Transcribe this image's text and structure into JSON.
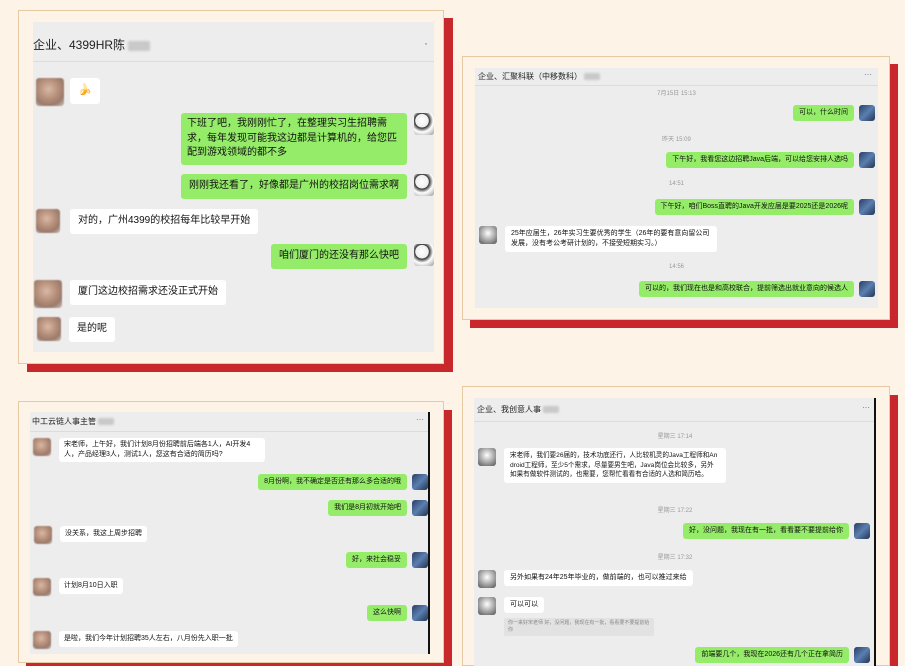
{
  "colors": {
    "accent": "#c8282b",
    "bubble_out": "#95ec69",
    "bubble_in": "#ffffff",
    "chat_bg": "#ededed",
    "page_bg": "#fdf3e7"
  },
  "panel1": {
    "title": "企业、4399HR陈",
    "more": "·",
    "messages": [
      {
        "side": "in",
        "text": "🍌"
      },
      {
        "side": "out",
        "text": "下班了吧，我刚刚忙了，在整理实习生招聘需求，每年发现可能我这边都是计算机的，给您匹配到游戏领域的都不多"
      },
      {
        "side": "out",
        "text": "刚刚我还看了，好像都是广州的校招岗位需求啊"
      },
      {
        "side": "in",
        "text": "对的，广州4399的校招每年比较早开始"
      },
      {
        "side": "out",
        "text": "咱们厦门的还没有那么快吧"
      },
      {
        "side": "in",
        "text": "厦门这边校招需求还没正式开始"
      },
      {
        "side": "in",
        "text": "是的呢"
      }
    ]
  },
  "panel2": {
    "title": "企业、汇聚科联（中移数科）",
    "more": "···",
    "ts": [
      "7月15日 15:13",
      "昨天 15:09",
      "14:51",
      "14:56"
    ],
    "messages": [
      {
        "side": "out",
        "text": "可以，什么时间"
      },
      {
        "side": "out",
        "text": "下午好，我看您这边招聘Java后端，可以给您安排人选吗"
      },
      {
        "side": "out",
        "text": "下午好，咱们Boss直聘的Java开发应届是要2025还是2026呢"
      },
      {
        "side": "in",
        "text": "25年应届生，26年实习生要优秀的学生（26年的要有意向留公司发展，没有考公考研计划的，不接受短期实习。）"
      },
      {
        "side": "out",
        "text": "可以的，我们现在也是和高校联合，提前筛选出就业意向的候选人"
      }
    ]
  },
  "panel3": {
    "title": "中工云链人事主管",
    "more": "···",
    "messages": [
      {
        "side": "in",
        "text": "宋老师，上午好，我们计划8月份招聘前后端各1人，AI开发4人，产品经理3人，测试1人，您这有合适的简历吗?"
      },
      {
        "side": "out",
        "text": "8月份啊，我不确定是否还有那么多合适的哦"
      },
      {
        "side": "out",
        "text": "我们是8月初就开始吧"
      },
      {
        "side": "in",
        "text": "没关系，我这上周步招聘"
      },
      {
        "side": "out",
        "text": "好，来社会稳妥"
      },
      {
        "side": "in",
        "text": "计划8月10日入职"
      },
      {
        "side": "out",
        "text": "这么快啊"
      },
      {
        "side": "in",
        "text": "是啦，我们今年计划招聘35人左右，八月份先入职一批"
      }
    ]
  },
  "panel4": {
    "title": "企业、我创意人事",
    "more": "···",
    "ts": [
      "星期三 17:14",
      "星期三 17:22",
      "星期三 17:32"
    ],
    "messages": [
      {
        "side": "in",
        "text": "宋老师，我们要26届的，技术功底还行，人比较机灵的Java工程师和Android工程师，至少5个需求，尽量要男生吧，Java岗位会比较多，另外如果有做软件测试的，也需要，您帮忙看看有合适的人选和简历哈。"
      },
      {
        "side": "out",
        "text": "好，没问题，我现在有一批，看看要不要提前给你"
      },
      {
        "side": "in",
        "text": "另外如果有24年25年毕业的，做前端的，也可以推过来给"
      },
      {
        "side": "in",
        "text": "可以可以"
      },
      {
        "side": "out",
        "text": "前端要几个，我现在2026还有几个正在拿简历"
      }
    ],
    "quote": "你一来好宋老师 好，没问题，我现在有一批，看看要不要提前给你"
  }
}
